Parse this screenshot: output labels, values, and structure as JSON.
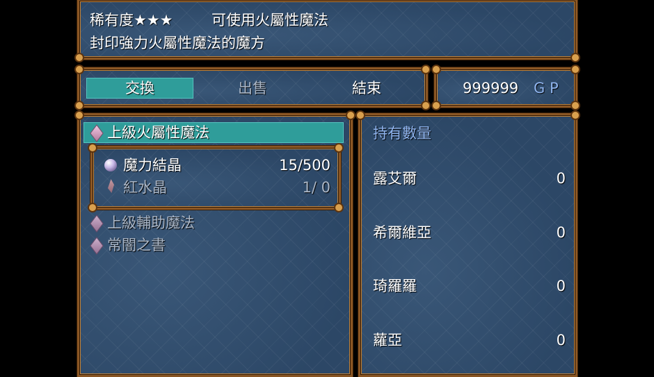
{
  "help": {
    "line1_rarity": "稀有度★★★",
    "line1_usage": "可使用火屬性魔法",
    "line2": "封印強力火屬性魔法的魔方"
  },
  "commands": [
    {
      "label": "交換",
      "state": "selected"
    },
    {
      "label": "出售",
      "state": "inactive"
    },
    {
      "label": "結束",
      "state": "active"
    }
  ],
  "gold": {
    "value": "999999",
    "unit": "G P"
  },
  "item_list": [
    {
      "label": "上級火屬性魔法",
      "selected": true
    },
    {
      "label": "上級輔助魔法",
      "selected": false
    },
    {
      "label": "常闇之書",
      "selected": false
    }
  ],
  "materials": [
    {
      "icon": "orb-icon",
      "name": "魔力結晶",
      "count": "15/500"
    },
    {
      "icon": "crystal-icon",
      "name": "紅水晶",
      "count": "1/  0"
    }
  ],
  "owned": {
    "title": "持有數量",
    "members": [
      {
        "name": "露艾爾",
        "count": "0"
      },
      {
        "name": "希爾維亞",
        "count": "0"
      },
      {
        "name": "琦羅羅",
        "count": "0"
      },
      {
        "name": "蘿亞",
        "count": "0"
      }
    ]
  },
  "colors": {
    "window_bg": "#2c4766",
    "frame": "#8a5624",
    "highlight": "#2f9d9a",
    "accent_text": "#8fb4ee",
    "dim_text": "#aab6c6"
  }
}
